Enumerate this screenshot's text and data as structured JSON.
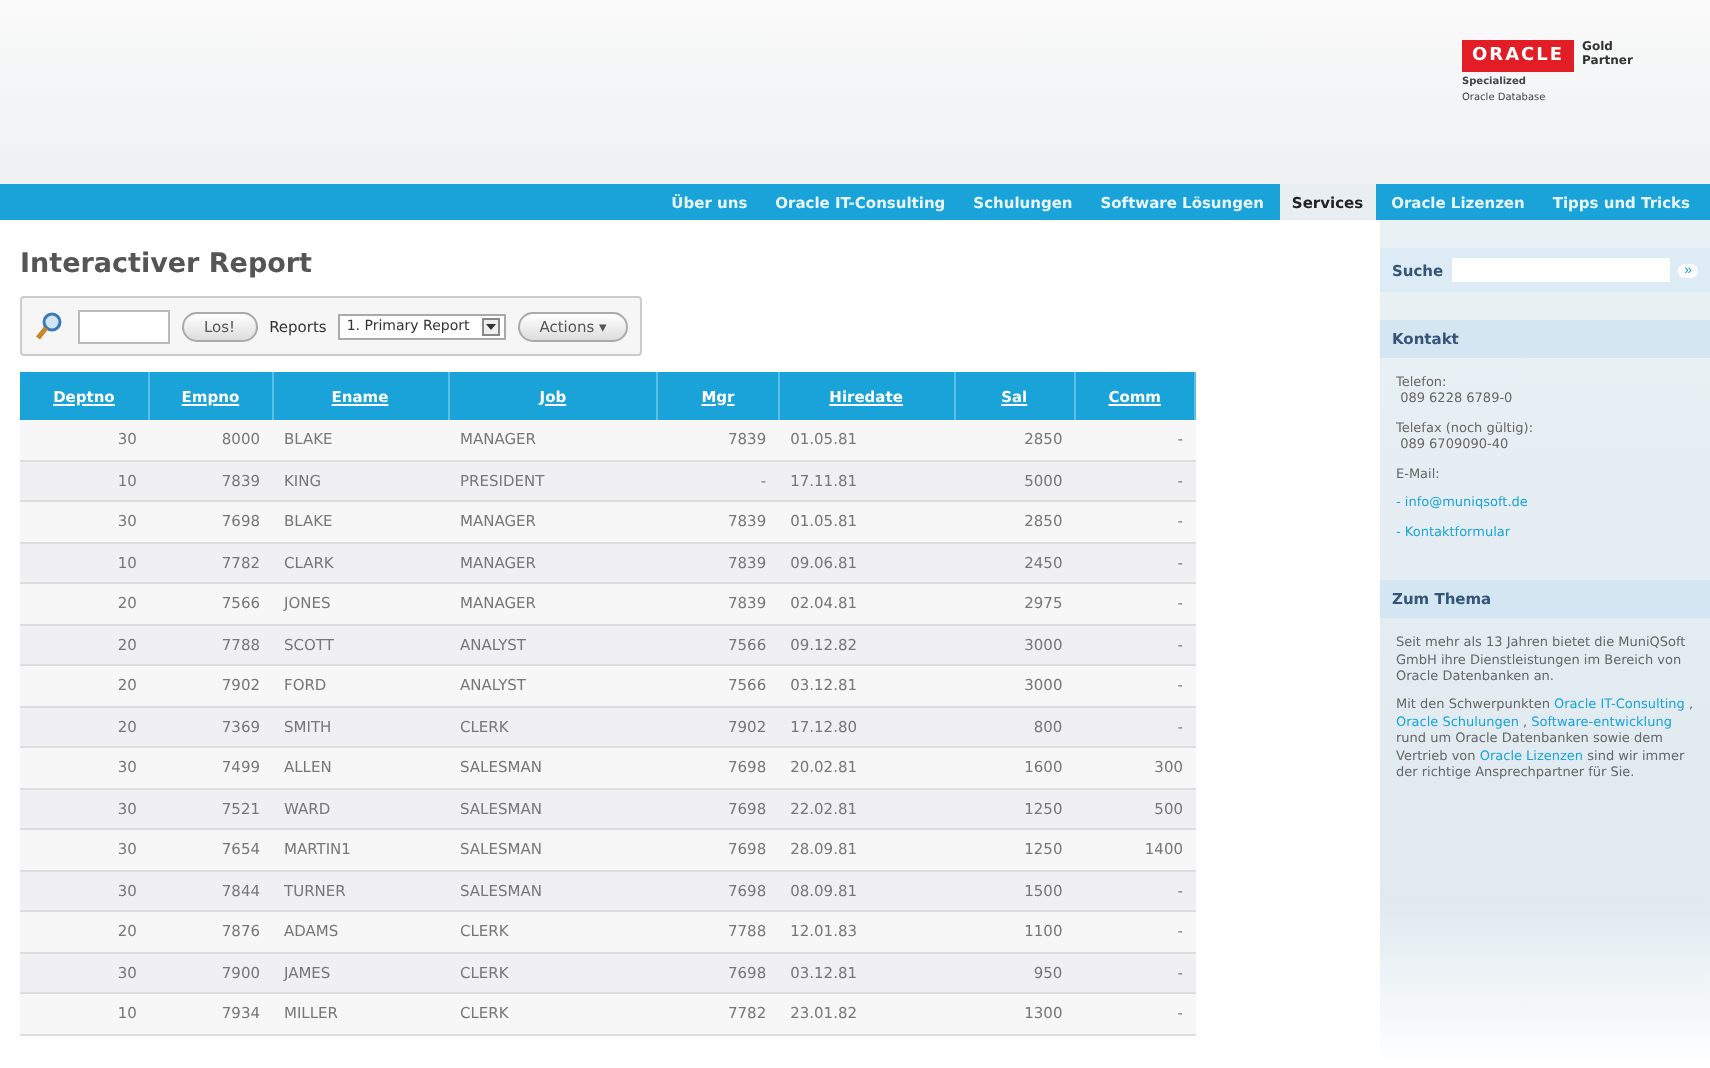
{
  "logo": {
    "brand": "ORACLE",
    "tier": "Gold Partner",
    "line1": "Specialized",
    "line2": "Oracle Database"
  },
  "nav": [
    {
      "label": "Über uns",
      "selected": false
    },
    {
      "label": "Oracle IT-Consulting",
      "selected": false
    },
    {
      "label": "Schulungen",
      "selected": false
    },
    {
      "label": "Software Lösungen",
      "selected": false
    },
    {
      "label": "Services",
      "selected": true
    },
    {
      "label": "Oracle Lizenzen",
      "selected": false
    },
    {
      "label": "Tipps und Tricks",
      "selected": false
    }
  ],
  "title": "Interactiver Report",
  "toolbar": {
    "go": "Los!",
    "reports_label": "Reports",
    "report": "1. Primary Report",
    "actions": "Actions ▾"
  },
  "table": {
    "columns": [
      "Deptno",
      "Empno",
      "Ename",
      "Job",
      "Mgr",
      "Hiredate",
      "Sal",
      "Comm"
    ],
    "rows": [
      [
        "30",
        "8000",
        "BLAKE",
        "MANAGER",
        "7839",
        "01.05.81",
        "2850",
        "-"
      ],
      [
        "10",
        "7839",
        "KING",
        "PRESIDENT",
        "-",
        "17.11.81",
        "5000",
        "-"
      ],
      [
        "30",
        "7698",
        "BLAKE",
        "MANAGER",
        "7839",
        "01.05.81",
        "2850",
        "-"
      ],
      [
        "10",
        "7782",
        "CLARK",
        "MANAGER",
        "7839",
        "09.06.81",
        "2450",
        "-"
      ],
      [
        "20",
        "7566",
        "JONES",
        "MANAGER",
        "7839",
        "02.04.81",
        "2975",
        "-"
      ],
      [
        "20",
        "7788",
        "SCOTT",
        "ANALYST",
        "7566",
        "09.12.82",
        "3000",
        "-"
      ],
      [
        "20",
        "7902",
        "FORD",
        "ANALYST",
        "7566",
        "03.12.81",
        "3000",
        "-"
      ],
      [
        "20",
        "7369",
        "SMITH",
        "CLERK",
        "7902",
        "17.12.80",
        "800",
        "-"
      ],
      [
        "30",
        "7499",
        "ALLEN",
        "SALESMAN",
        "7698",
        "20.02.81",
        "1600",
        "300"
      ],
      [
        "30",
        "7521",
        "WARD",
        "SALESMAN",
        "7698",
        "22.02.81",
        "1250",
        "500"
      ],
      [
        "30",
        "7654",
        "MARTIN1",
        "SALESMAN",
        "7698",
        "28.09.81",
        "1250",
        "1400"
      ],
      [
        "30",
        "7844",
        "TURNER",
        "SALESMAN",
        "7698",
        "08.09.81",
        "1500",
        "-"
      ],
      [
        "20",
        "7876",
        "ADAMS",
        "CLERK",
        "7788",
        "12.01.83",
        "1100",
        "-"
      ],
      [
        "30",
        "7900",
        "JAMES",
        "CLERK",
        "7698",
        "03.12.81",
        "950",
        "-"
      ],
      [
        "10",
        "7934",
        "MILLER",
        "CLERK",
        "7782",
        "23.01.82",
        "1300",
        "-"
      ]
    ]
  },
  "sidebar": {
    "search_label": "Suche",
    "search_button": "»",
    "contact": {
      "heading": "Kontakt",
      "blocks": [
        {
          "kind": "text",
          "label": "Telefon:",
          "value": "089 6228 6789-0"
        },
        {
          "kind": "text",
          "label": "Telefax (noch gültig):",
          "value": "089 6709090-40"
        },
        {
          "kind": "text",
          "label": "E-Mail:"
        },
        {
          "kind": "link",
          "value": "- info@muniqsoft.de"
        },
        {
          "kind": "link",
          "value": "- Kontaktformular"
        }
      ]
    },
    "topic": {
      "heading": "Zum Thema",
      "paragraphs": [
        [
          {
            "kind": "text",
            "text": "Seit mehr als 13 Jahren bietet die MuniQSoft GmbH ihre Dienstleistungen im Bereich von Oracle Datenbanken an."
          }
        ],
        [
          {
            "kind": "text",
            "text": "Mit den Schwerpunkten "
          },
          {
            "kind": "link",
            "text": "Oracle IT-Consulting"
          },
          {
            "kind": "text",
            "text": " , "
          },
          {
            "kind": "link",
            "text": "Oracle Schulungen"
          },
          {
            "kind": "text",
            "text": " , "
          },
          {
            "kind": "link",
            "text": "Software-entwicklung"
          },
          {
            "kind": "text",
            "text": " rund um Oracle Datenbanken sowie dem Vertrieb von "
          },
          {
            "kind": "link",
            "text": "Oracle Lizenzen"
          },
          {
            "kind": "text",
            "text": " sind wir immer der richtige Ansprechpartner für Sie."
          }
        ]
      ]
    }
  }
}
